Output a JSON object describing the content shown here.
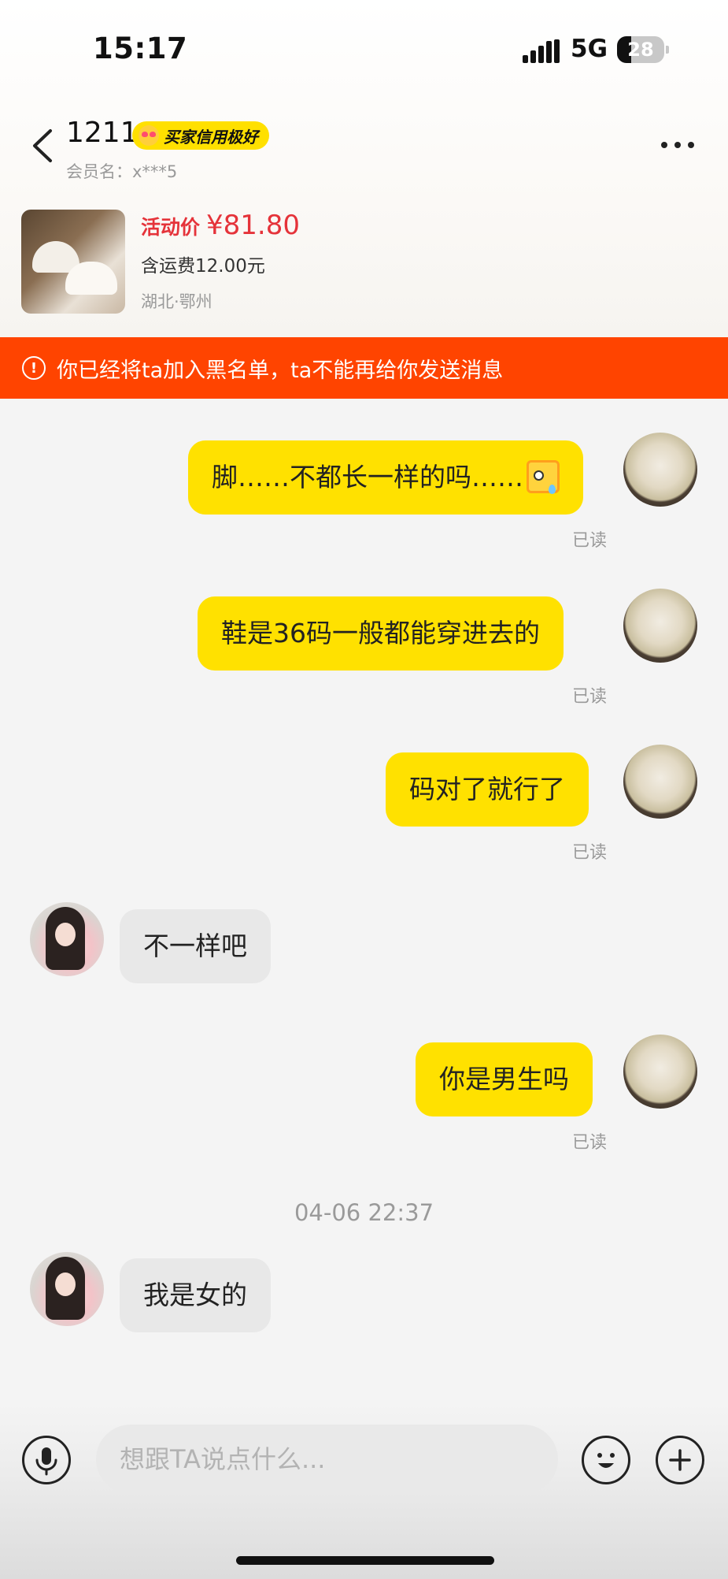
{
  "status_bar": {
    "time": "15:17",
    "network": "5G",
    "battery": "28"
  },
  "header": {
    "user_name": "1211",
    "credit_badge": "买家信用极好",
    "member_label": "会员名：x***5"
  },
  "product": {
    "price_label": "活动价",
    "price": "¥81.80",
    "shipping": "含运费12.00元",
    "location": "湖北·鄂州"
  },
  "banner": {
    "text": "你已经将ta加入黑名单，ta不能再给你发送消息"
  },
  "messages": [
    {
      "from": "me",
      "text": "脚……不都长一样的吗……",
      "emoji": "sweat-emoji",
      "status": "已读"
    },
    {
      "from": "me",
      "text": "鞋是36码一般都能穿进去的",
      "status": "已读"
    },
    {
      "from": "me",
      "text": "码对了就行了",
      "status": "已读"
    },
    {
      "from": "other",
      "text": "不一样吧"
    },
    {
      "from": "me",
      "text": "你是男生吗",
      "status": "已读"
    },
    {
      "from": "other",
      "text": "我是女的"
    }
  ],
  "timestamp": "04-06 22:37",
  "input": {
    "placeholder": "想跟TA说点什么..."
  },
  "colors": {
    "accent": "#ffe100",
    "banner": "#ff4400",
    "price": "#e5333a"
  }
}
